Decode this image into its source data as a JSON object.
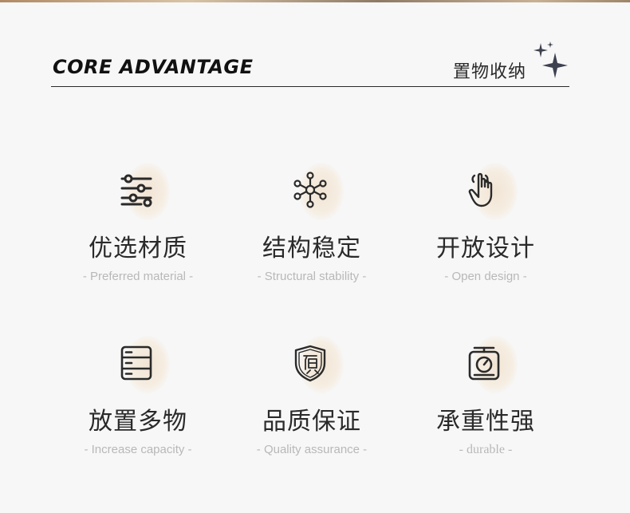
{
  "header": {
    "title_en": "CORE ADVANTAGE",
    "title_cn": "置物收纳"
  },
  "features": [
    {
      "icon": "sliders-icon",
      "title": "优选材质",
      "subtitle": "- Preferred material -"
    },
    {
      "icon": "network-icon",
      "title": "结构稳定",
      "subtitle": "- Structural stability -"
    },
    {
      "icon": "hand-pointer-icon",
      "title": "开放设计",
      "subtitle": "- Open design -"
    },
    {
      "icon": "stacked-drawers-icon",
      "title": "放置多物",
      "subtitle": "- Increase capacity -"
    },
    {
      "icon": "quality-shield-icon",
      "title": "品质保证",
      "subtitle": "- Quality assurance -"
    },
    {
      "icon": "weighing-scale-icon",
      "title": "承重性强",
      "subtitle": "- durable -"
    }
  ],
  "colors": {
    "text": "#2a2a2a",
    "subtext": "#b8b8b8",
    "accent_glow": "#f1e4d3",
    "sparkle": "#3d4150"
  }
}
